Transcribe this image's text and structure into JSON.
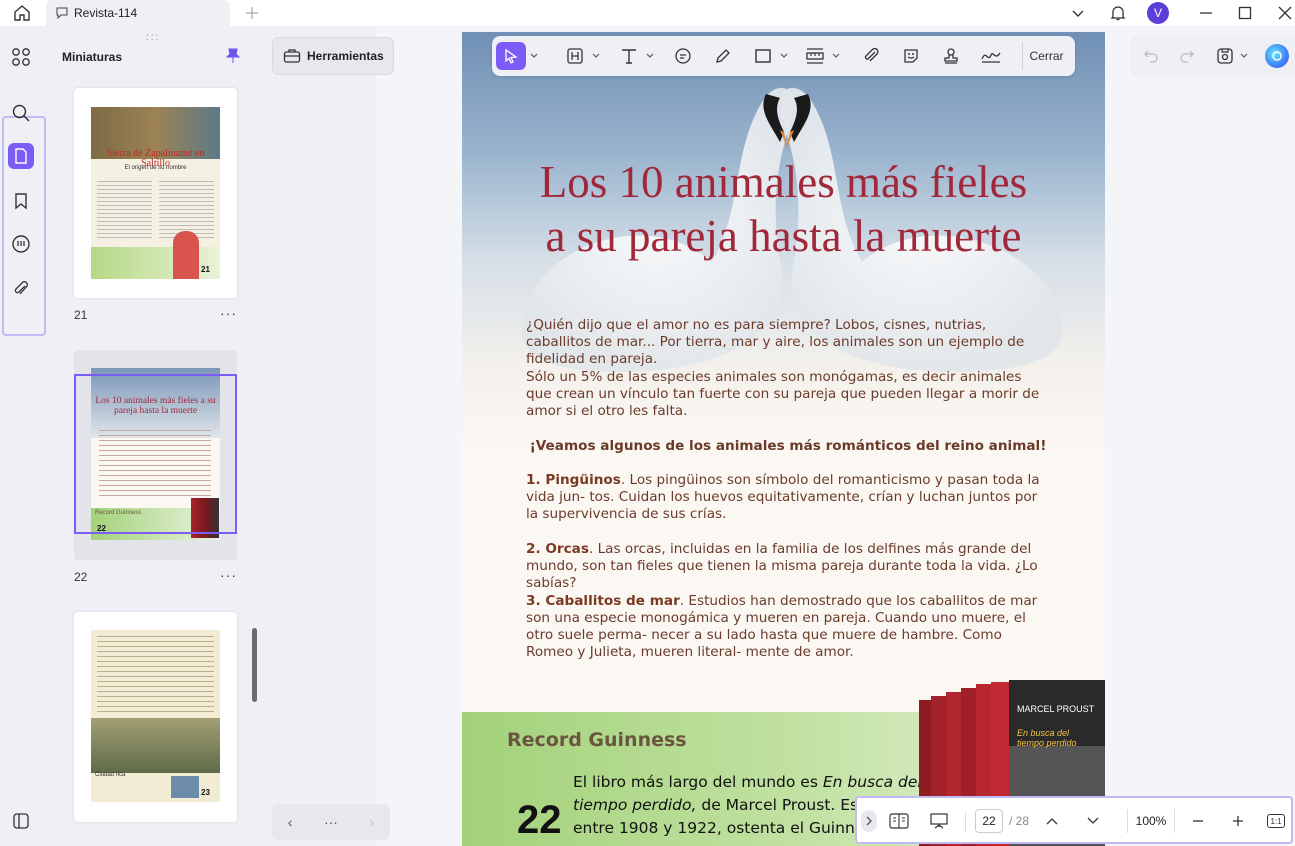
{
  "window": {
    "tab_title": "Revista-114",
    "user_initial": "V"
  },
  "sidebar": {
    "panel_title": "Miniaturas"
  },
  "thumbnails": [
    {
      "page": "21",
      "more": "···",
      "title": "Sierra de Zapalinamé en Saltillo",
      "subtitle": "El origen de su nombre",
      "badge": "21"
    },
    {
      "page": "22",
      "more": "···",
      "title": "Los 10 animales más fieles a su pareja hasta la muerte",
      "badge": "22",
      "footer": "Record Guinness"
    },
    {
      "page": "23",
      "more": "···",
      "badge": "23",
      "footer": "Ciudad rica"
    }
  ],
  "toolbar": {
    "tools_label": "Herramientas",
    "close_label": "Cerrar"
  },
  "pager": {
    "prev": "‹",
    "dots": "···",
    "next": "›"
  },
  "document": {
    "title_line1": "Los 10 animales más fieles",
    "title_line2": "a su pareja hasta la muerte",
    "intro1": "¿Quién dijo que el amor no es para siempre? Lobos, cisnes, nutrias, caballitos de mar... Por tierra, mar y aire, los animales son un ejemplo de fidelidad en pareja.",
    "intro2": "Sólo un 5% de las especies animales son monógamas, es decir animales que crean un vínculo tan fuerte con su pareja que pueden llegar a morir de amor si el otro les falta.",
    "headline": "¡Veamos algunos de los animales más románticos del reino animal!",
    "items": [
      {
        "name": "1. Pingüinos",
        "text": ". Los pingüinos son símbolo del romanticismo y pasan toda la vida jun- tos. Cuidan los huevos equitativamente, crían y luchan juntos por la supervivencia de sus crías."
      },
      {
        "name": "2. Orcas",
        "text": ". Las orcas, incluidas en la familia de los delfines más grande del mundo, son tan fieles que tienen la misma pareja durante toda la vida. ¿Lo sabías?"
      },
      {
        "name": "3. Caballitos de mar",
        "text": ". Estudios han demostrado que los caballitos de mar son una especie monogámica y mueren en pareja. Cuando uno muere, el otro suele perma- necer a su lado hasta que muere de hambre. Como Romeo y Julieta, mueren literal- mente de amor."
      }
    ],
    "record_title": "Record Guinness",
    "page_number": "22",
    "record_text_1": "El libro más largo del mundo es ",
    "record_text_italic": "En busca del tiempo perdido,",
    "record_text_2": " de Marcel Proust. Es",
    "record_text_3": "entre 1908 y 1922, ostenta el Guinne",
    "book_author": "MARCEL PROUST",
    "book_title": "En busca del tiempo perdido"
  },
  "statusbar": {
    "current_page": "22",
    "total_pages": "/ 28",
    "zoom": "100%",
    "fit_label": "1:1"
  }
}
